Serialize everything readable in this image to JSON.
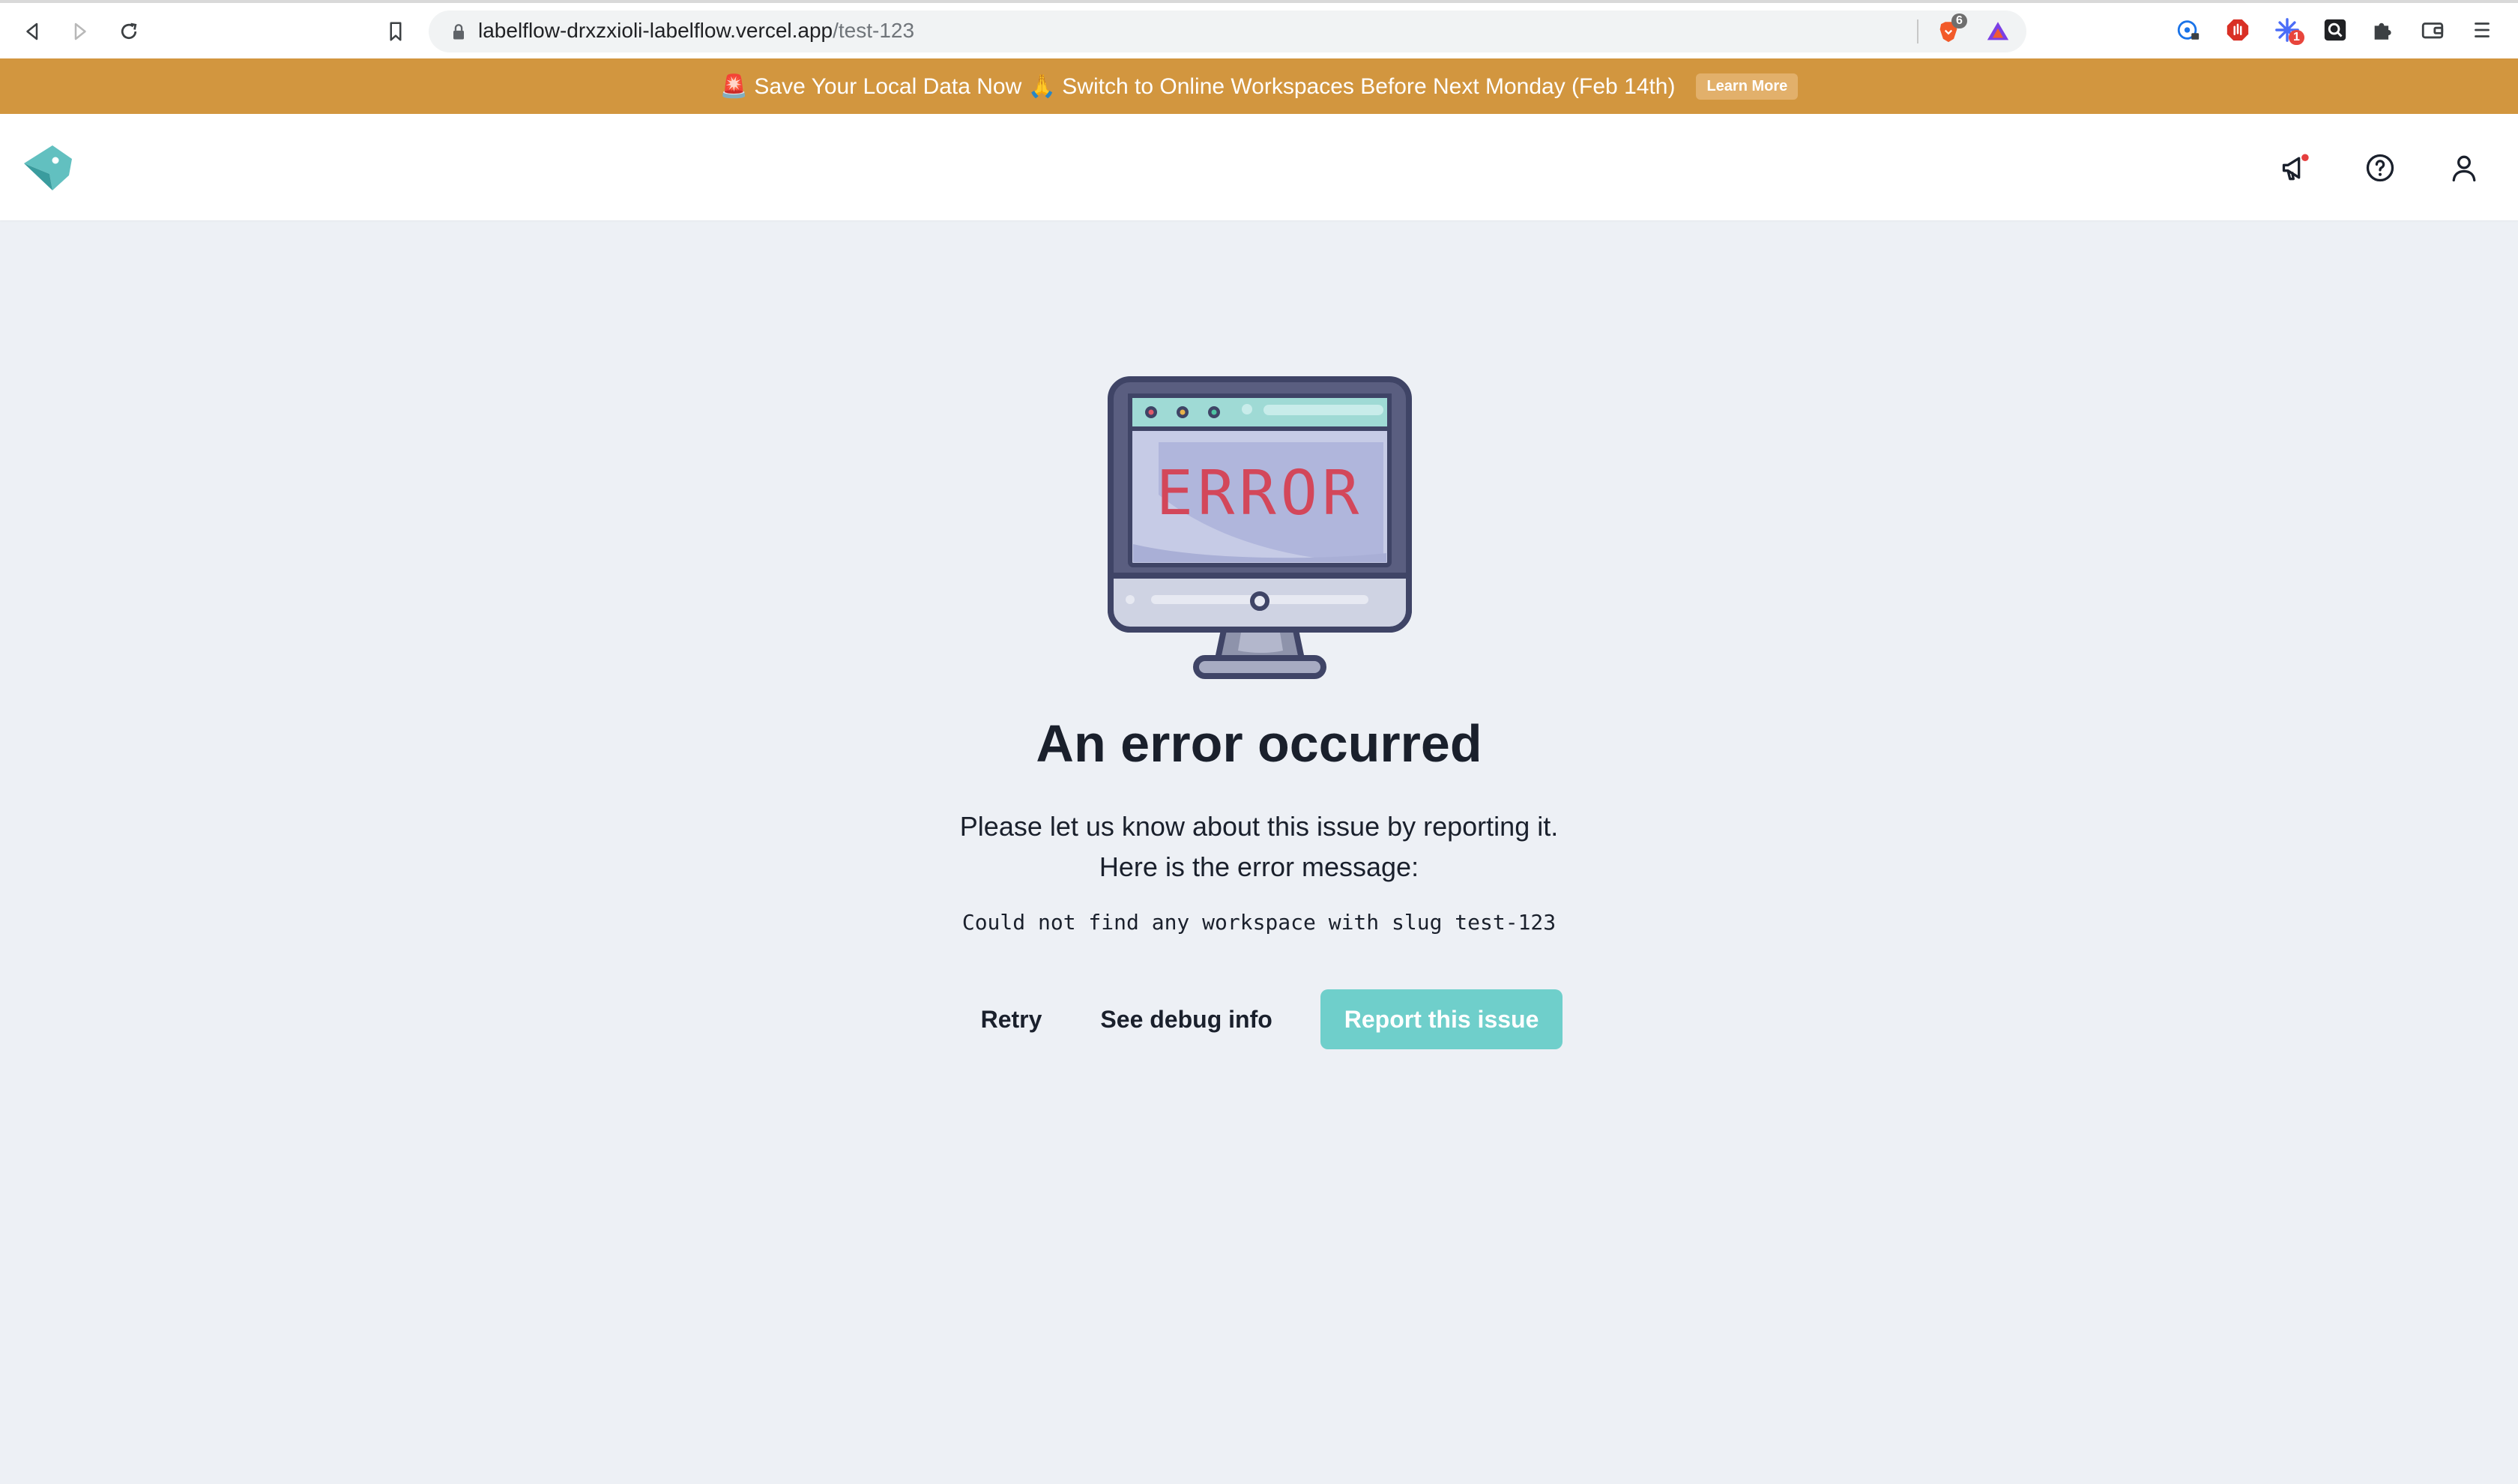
{
  "browser": {
    "url_host": "labelflow-drxzxioli-labelflow.vercel.app",
    "url_path": "/test-123",
    "brave_badge": "6",
    "extension_badge": "1"
  },
  "banner": {
    "text": "🚨 Save Your Local Data Now 🙏 Switch to Online Workspaces Before Next Monday (Feb 14th)",
    "button_label": "Learn More",
    "color": "#d2963f"
  },
  "header": {
    "icons": [
      "logo-icon",
      "megaphone-icon",
      "help-icon",
      "user-icon"
    ]
  },
  "error": {
    "illustration_text": "ERROR",
    "title": "An error occurred",
    "description_line1": "Please let us know about this issue by reporting it.",
    "description_line2": "Here is the error message:",
    "message": "Could not find any workspace with slug test-123"
  },
  "actions": {
    "retry_label": "Retry",
    "debug_label": "See debug info",
    "report_label": "Report this issue",
    "accent": "#6fcfcb"
  }
}
